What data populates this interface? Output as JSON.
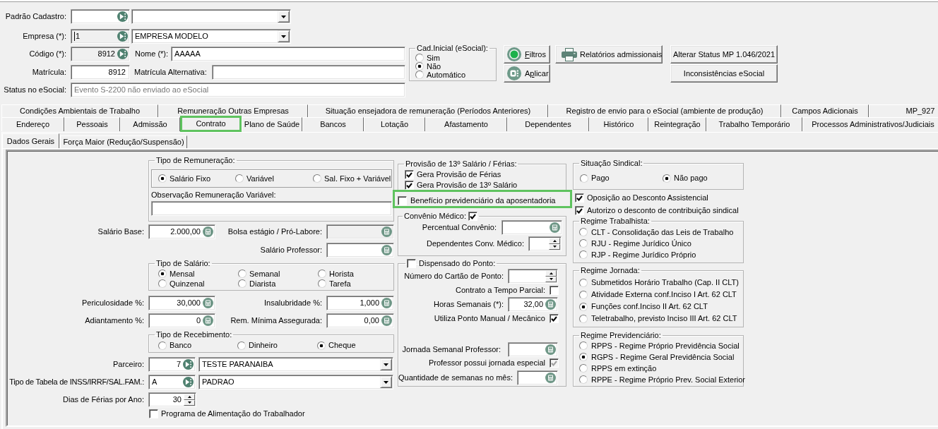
{
  "header": {
    "padrao_cadastro": {
      "label": "Padrão Cadastro:"
    },
    "empresa": {
      "label": "Empresa (*):",
      "code": {
        "value": "1",
        "read_only": true,
        "focused": true
      },
      "name": "EMPRESA MODELO"
    },
    "codigo": {
      "label": "Código (*):",
      "value": "8912",
      "read_only": true
    },
    "nome": {
      "label": "Nome (*):",
      "value": "AAAAA"
    },
    "matricula": {
      "label": "Matrícula:",
      "value": "8912"
    },
    "matricula_alternativa": {
      "label": "Matrícula Alternativa:"
    },
    "status_esocial": {
      "label": "Status no eSocial:",
      "value": "Evento S-2200 não enviado ao eSocial",
      "disabled": true
    }
  },
  "cad_inicial": {
    "title": "Cad.Inicial (eSocial):",
    "options": [
      {
        "label": "Sim",
        "selected": false
      },
      {
        "label": "Não",
        "selected": true
      },
      {
        "label": "Automático",
        "selected": false
      }
    ]
  },
  "buttons": {
    "filtros": {
      "access_key": "F",
      "label_after": "iltros"
    },
    "aplicar": {
      "label_before": "A",
      "access_key": "p",
      "label_after": "licar"
    },
    "relatorios": {
      "label": "Relatórios admissionais"
    },
    "alterar_status": {
      "label": "Alterar Status MP 1.046/2021"
    },
    "inconsistencias": {
      "label": "Inconsistências eSocial"
    }
  },
  "tabs": {
    "back_row": [
      {
        "label": "Condições Ambientais de Trabalho",
        "selected": false,
        "highlighted": false
      },
      {
        "label": "Remuneração Outras Empresas",
        "selected": false,
        "highlighted": false
      },
      {
        "label": "Situação ensejadora de remuneração (Períodos Anteriores)",
        "selected": false,
        "highlighted": false
      },
      {
        "label": "Registro de envio para o eSocial (ambiente de produção)",
        "selected": false,
        "highlighted": false
      },
      {
        "label": "Campos Adicionais",
        "selected": false,
        "highlighted": false
      },
      {
        "label": "MP_927",
        "selected": false,
        "highlighted": false
      }
    ],
    "front_row": [
      {
        "label": "Endereço",
        "selected": false,
        "highlighted": false
      },
      {
        "label": "Pessoais",
        "selected": false,
        "highlighted": false
      },
      {
        "label": "Admissão",
        "selected": false,
        "highlighted": false
      },
      {
        "label": "Contrato",
        "selected": true,
        "highlighted": true
      },
      {
        "label": "Plano de Saúde",
        "selected": false,
        "highlighted": false
      },
      {
        "label": "Bancos",
        "selected": false,
        "highlighted": false
      },
      {
        "label": "Lotação",
        "selected": false,
        "highlighted": false
      },
      {
        "label": "Afastamento",
        "selected": false,
        "highlighted": false
      },
      {
        "label": "Dependentes",
        "selected": false,
        "highlighted": false
      },
      {
        "label": "Histórico",
        "selected": false,
        "highlighted": false
      },
      {
        "label": "Reintegração",
        "selected": false,
        "highlighted": false
      },
      {
        "label": "Trabalho Temporário",
        "selected": false,
        "highlighted": false
      },
      {
        "label": "Processos Administrativos/Judiciais",
        "selected": false,
        "highlighted": false
      }
    ]
  },
  "subtabs": [
    {
      "label": "Dados Gerais",
      "selected": true
    },
    {
      "label": "Força Maior (Redução/Suspensão)",
      "selected": false
    }
  ],
  "dados_gerais": {
    "tipo_remuneracao": {
      "title": "Tipo de Remuneração:",
      "options": [
        {
          "label": "Salário Fixo",
          "selected": true
        },
        {
          "label": "Variável",
          "selected": false
        },
        {
          "label": "Sal. Fixo + Variável",
          "selected": false
        }
      ],
      "observacao": {
        "label": "Observação Remuneração Variável:"
      }
    },
    "salario_base": {
      "label": "Salário Base:",
      "value": "2.000,00"
    },
    "bolsa_estagio": {
      "label": "Bolsa estágio / Pró-Labore:",
      "read_only": true
    },
    "salario_professor": {
      "label": "Salário Professor:"
    },
    "tipo_salario": {
      "title": "Tipo de Salário:",
      "options": [
        {
          "label": "Mensal",
          "selected": true
        },
        {
          "label": "Semanal",
          "selected": false
        },
        {
          "label": "Horista",
          "selected": false
        },
        {
          "label": "Quinzenal",
          "selected": false
        },
        {
          "label": "Diarista",
          "selected": false
        },
        {
          "label": "Tarefa",
          "selected": false
        }
      ]
    },
    "periculosidade": {
      "label": "Periculosidade %:",
      "value": "30,000"
    },
    "insalubridade": {
      "label": "Insalubridade %:",
      "value": "1,000"
    },
    "adiantamento": {
      "label": "Adiantamento %:",
      "value": "0"
    },
    "rem_minima": {
      "label": "Rem. Mínima Assegurada:",
      "value": "0,00"
    },
    "tipo_recebimento": {
      "title": "Tipo de Recebimento:",
      "options": [
        {
          "label": "Banco",
          "selected": false
        },
        {
          "label": "Dinheiro",
          "selected": false
        },
        {
          "label": "Cheque",
          "selected": true
        }
      ]
    },
    "parceiro": {
      "label": "Parceiro:",
      "code": "7",
      "name": "TESTE PARANAIBA"
    },
    "tipo_tabela": {
      "label": "Tipo de Tabela de INSS/IRRF/SAL.FAM.:",
      "code": "A",
      "name": "PADRAO"
    },
    "dias_ferias": {
      "label": "Dias de Férias por Ano:",
      "value": "30"
    },
    "programa_alimentacao": {
      "label": "Programa de Alimentação do Trabalhador",
      "checked": false
    },
    "provisao": {
      "title": "Provisão de 13º Salário / Férias:",
      "options": [
        {
          "label": "Gera Provisão de Férias",
          "checked": true
        },
        {
          "label": "Gera Provisão de 13º Salário",
          "checked": true
        }
      ]
    },
    "beneficio": {
      "label": "Benefício previdenciário da aposentadoria",
      "checked": false,
      "highlighted": true
    },
    "convenio_medico": {
      "title": "Convênio Médico:",
      "checked": true,
      "percentual": {
        "label": "Percentual Convênio:"
      },
      "dependentes": {
        "label": "Dependentes Conv. Médico:"
      }
    },
    "dispensado_ponto": {
      "title": "Dispensado do Ponto:",
      "checked": false,
      "numero_cartao": {
        "label": "Número do Cartão de Ponto:"
      },
      "tempo_parcial": {
        "label": "Contrato a Tempo Parcial:",
        "checked": false
      },
      "horas_semanais": {
        "label": "Horas Semanais (*):",
        "value": "32,00"
      },
      "ponto_manual": {
        "label": "Utiliza Ponto Manual / Mecânico",
        "checked": true
      },
      "jornada_professor": {
        "label": "Jornada Semanal Professor:"
      },
      "jornada_especial": {
        "label": "Professor possui jornada especial",
        "checked": true,
        "disabled": true
      },
      "semanas_mes": {
        "label": "Quantidade de semanas no mês:"
      }
    },
    "situacao_sindical": {
      "title": "Situação Sindical:",
      "options": [
        {
          "label": "Pago",
          "selected": false
        },
        {
          "label": "Não pago",
          "selected": true
        }
      ]
    },
    "oposicao": {
      "label": "Oposição ao Desconto Assistencial",
      "checked": true
    },
    "autorizo": {
      "label": "Autorizo o desconto de contribuição sindical",
      "checked": true
    },
    "regime_trabalhista": {
      "title": "Regime Trabalhista:",
      "options": [
        {
          "label": "CLT - Consolidação das Leis de Trabalho",
          "selected": false
        },
        {
          "label": "RJU - Regime Jurídico Único",
          "selected": false
        },
        {
          "label": "RJP - Regime Jurídico Próprio",
          "selected": false
        }
      ]
    },
    "regime_jornada": {
      "title": "Regime Jornada:",
      "options": [
        {
          "label": "Submetidos Horário Trabalho (Cap. II CLT)",
          "selected": false
        },
        {
          "label": "Atividade Externa conf.Inciso I Art. 62 CLT",
          "selected": false
        },
        {
          "label": "Funções conf.Inciso II Art. 62 CLT",
          "selected": true
        },
        {
          "label": "Teletrabalho, previsto Inciso III Art. 62 CLT",
          "selected": false
        }
      ]
    },
    "regime_previdenciario": {
      "title": "Regime Previdenciário:",
      "options": [
        {
          "label": "RPPS - Regime Próprio Previdência Social",
          "selected": false
        },
        {
          "label": "RGPS - Regime Geral Previdência Social",
          "selected": true
        },
        {
          "label": "RPPS em extinção",
          "selected": false
        },
        {
          "label": "RPPE - Regime Próprio Prev. Social Exterior",
          "selected": false
        }
      ]
    }
  }
}
